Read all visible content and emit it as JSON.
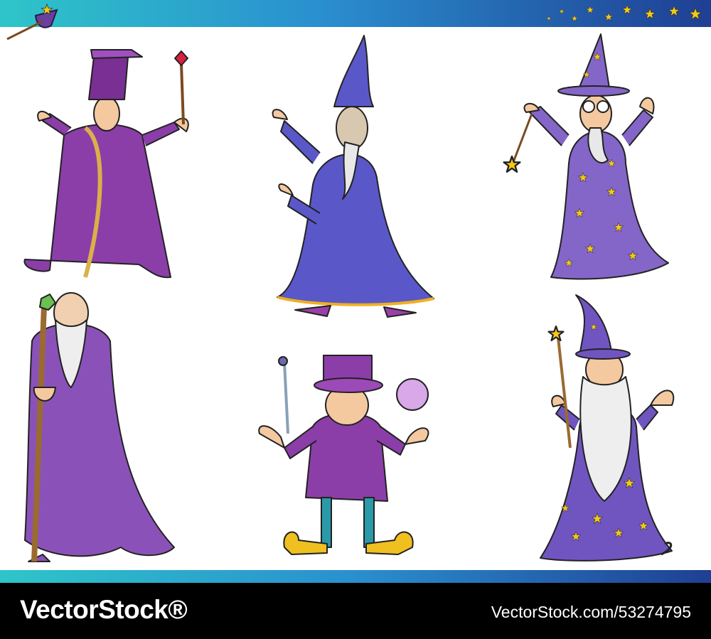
{
  "artwork": {
    "subject": "cartoon wizards set",
    "figures": [
      {
        "id": "wizard-1",
        "icon": "wizard-ruby-wand"
      },
      {
        "id": "wizard-2",
        "icon": "wizard-grinning"
      },
      {
        "id": "wizard-3",
        "icon": "wizard-star-robe"
      },
      {
        "id": "wizard-4",
        "icon": "wizard-old-staff"
      },
      {
        "id": "wizard-5",
        "icon": "magician-top-hat"
      },
      {
        "id": "wizard-6",
        "icon": "wizard-bearded-stars"
      }
    ],
    "colors": {
      "purple": "#8b3ea8",
      "violet": "#6a4fb0",
      "blue_robe": "#5a58c8",
      "star_robe": "#8466c8",
      "star": "#f6c915",
      "skin": "#f4c9a0",
      "beard": "#eeeeee",
      "teal_band": "#2ec5c9",
      "navy_band": "#1f3f93"
    }
  },
  "footer": {
    "logo": "VectorStock®",
    "id_text": "VectorStock.com/53274795"
  }
}
